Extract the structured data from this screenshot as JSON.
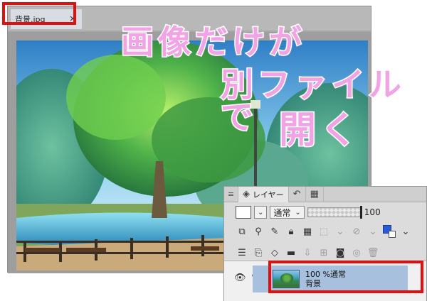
{
  "document": {
    "tab_label": "背景.jpg",
    "tab_close": "×"
  },
  "annotation": {
    "line1": "画像だけが",
    "line2": "別ファイルで",
    "line3": "開く",
    "color": "#f2a3e6"
  },
  "layer_panel": {
    "menu_icon": "≡",
    "tab_layer_label": "レイヤー",
    "blend_mode": "通常",
    "opacity": "100",
    "layer": {
      "opacity_mode": "100 %通常",
      "name": "背景"
    }
  },
  "colors": {
    "highlight": "#e01010",
    "selected_layer": "#a6c0de"
  }
}
